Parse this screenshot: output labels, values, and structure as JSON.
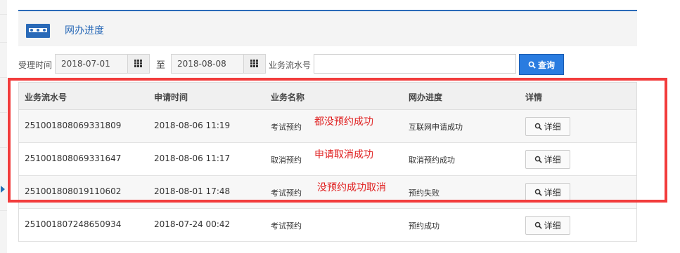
{
  "header": {
    "title": "网办进度",
    "icon": "card-icon"
  },
  "search": {
    "accept_time_label": "受理时间",
    "start_date": "2018-07-01",
    "to_label": "至",
    "end_date": "2018-08-08",
    "serial_label": "业务流水号",
    "serial_value": "",
    "query_label": "查询"
  },
  "table": {
    "columns": [
      "业务流水号",
      "申请时间",
      "业务名称",
      "网办进度",
      "详情"
    ],
    "rows": [
      {
        "serial": "251001808069331809",
        "time": "2018-08-06 11:19",
        "business": "考试预约",
        "progress": "互联网申请成功",
        "detail": "详细",
        "note": "都没预约成功"
      },
      {
        "serial": "251001808069331647",
        "time": "2018-08-06 11:17",
        "business": "取消预约",
        "progress": "取消预约成功",
        "detail": "详细",
        "note": "申请取消成功"
      },
      {
        "serial": "251001808019110602",
        "time": "2018-08-01 17:48",
        "business": "考试预约",
        "progress": "预约失败",
        "detail": "详细",
        "note": "没预约成功取消"
      },
      {
        "serial": "251001807248650934",
        "time": "2018-07-24 00:42",
        "business": "考试预约",
        "progress": "预约成功",
        "detail": "详细",
        "note": ""
      }
    ]
  },
  "colors": {
    "accent": "#2a6ab8",
    "button_blue": "#2a7ce0",
    "annotation_red": "#e02020",
    "highlight_red": "#f23c3c"
  }
}
